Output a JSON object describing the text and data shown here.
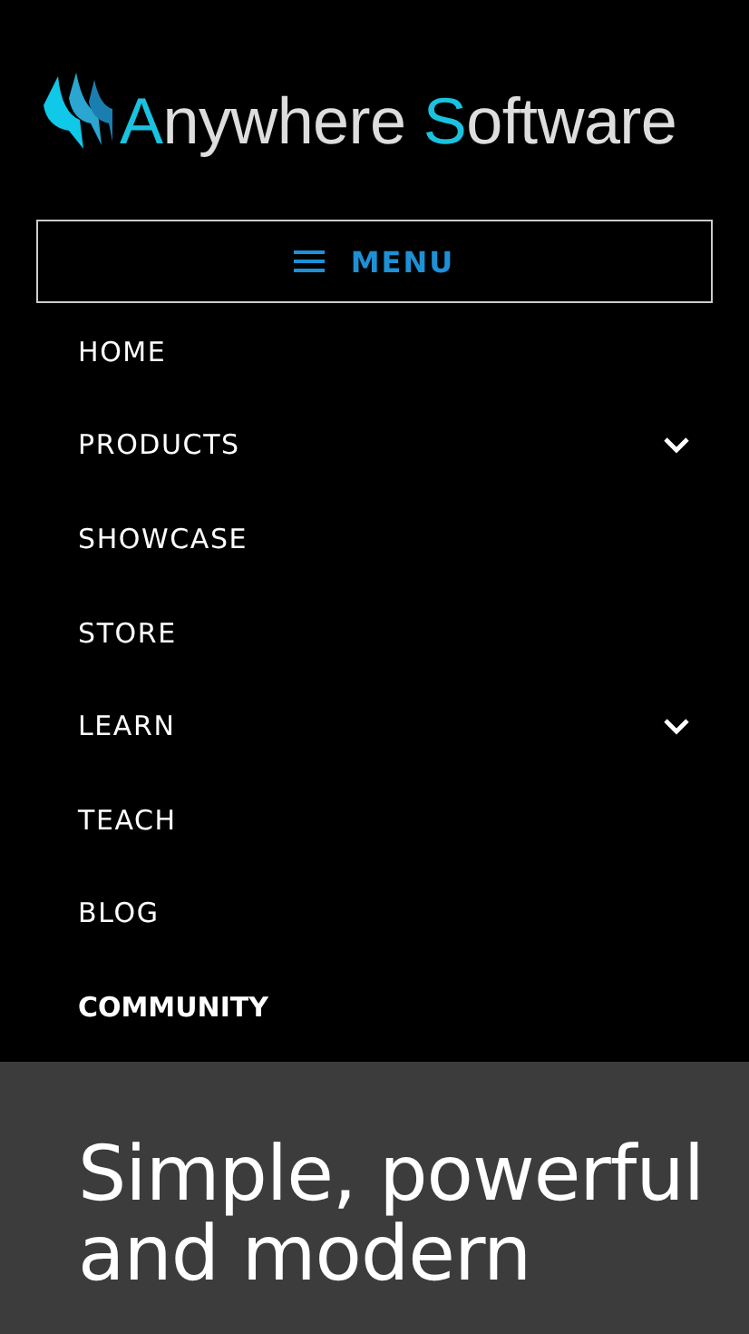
{
  "logo": {
    "parts": [
      {
        "text": "A",
        "accent": true
      },
      {
        "text": "nywhere ",
        "accent": false
      },
      {
        "text": "S",
        "accent": true
      },
      {
        "text": "oftware",
        "accent": false
      }
    ]
  },
  "menu_button": {
    "label": "MENU"
  },
  "nav": {
    "items": [
      {
        "label": "HOME",
        "expandable": false,
        "selected": false
      },
      {
        "label": "PRODUCTS",
        "expandable": true,
        "selected": false
      },
      {
        "label": "SHOWCASE",
        "expandable": false,
        "selected": false
      },
      {
        "label": "STORE",
        "expandable": false,
        "selected": false
      },
      {
        "label": "LEARN",
        "expandable": true,
        "selected": false
      },
      {
        "label": "TEACH",
        "expandable": false,
        "selected": false
      },
      {
        "label": "BLOG",
        "expandable": false,
        "selected": false
      },
      {
        "label": "COMMUNITY",
        "expandable": false,
        "selected": true
      }
    ]
  },
  "hero": {
    "heading": "Simple, powerful and modern"
  }
}
